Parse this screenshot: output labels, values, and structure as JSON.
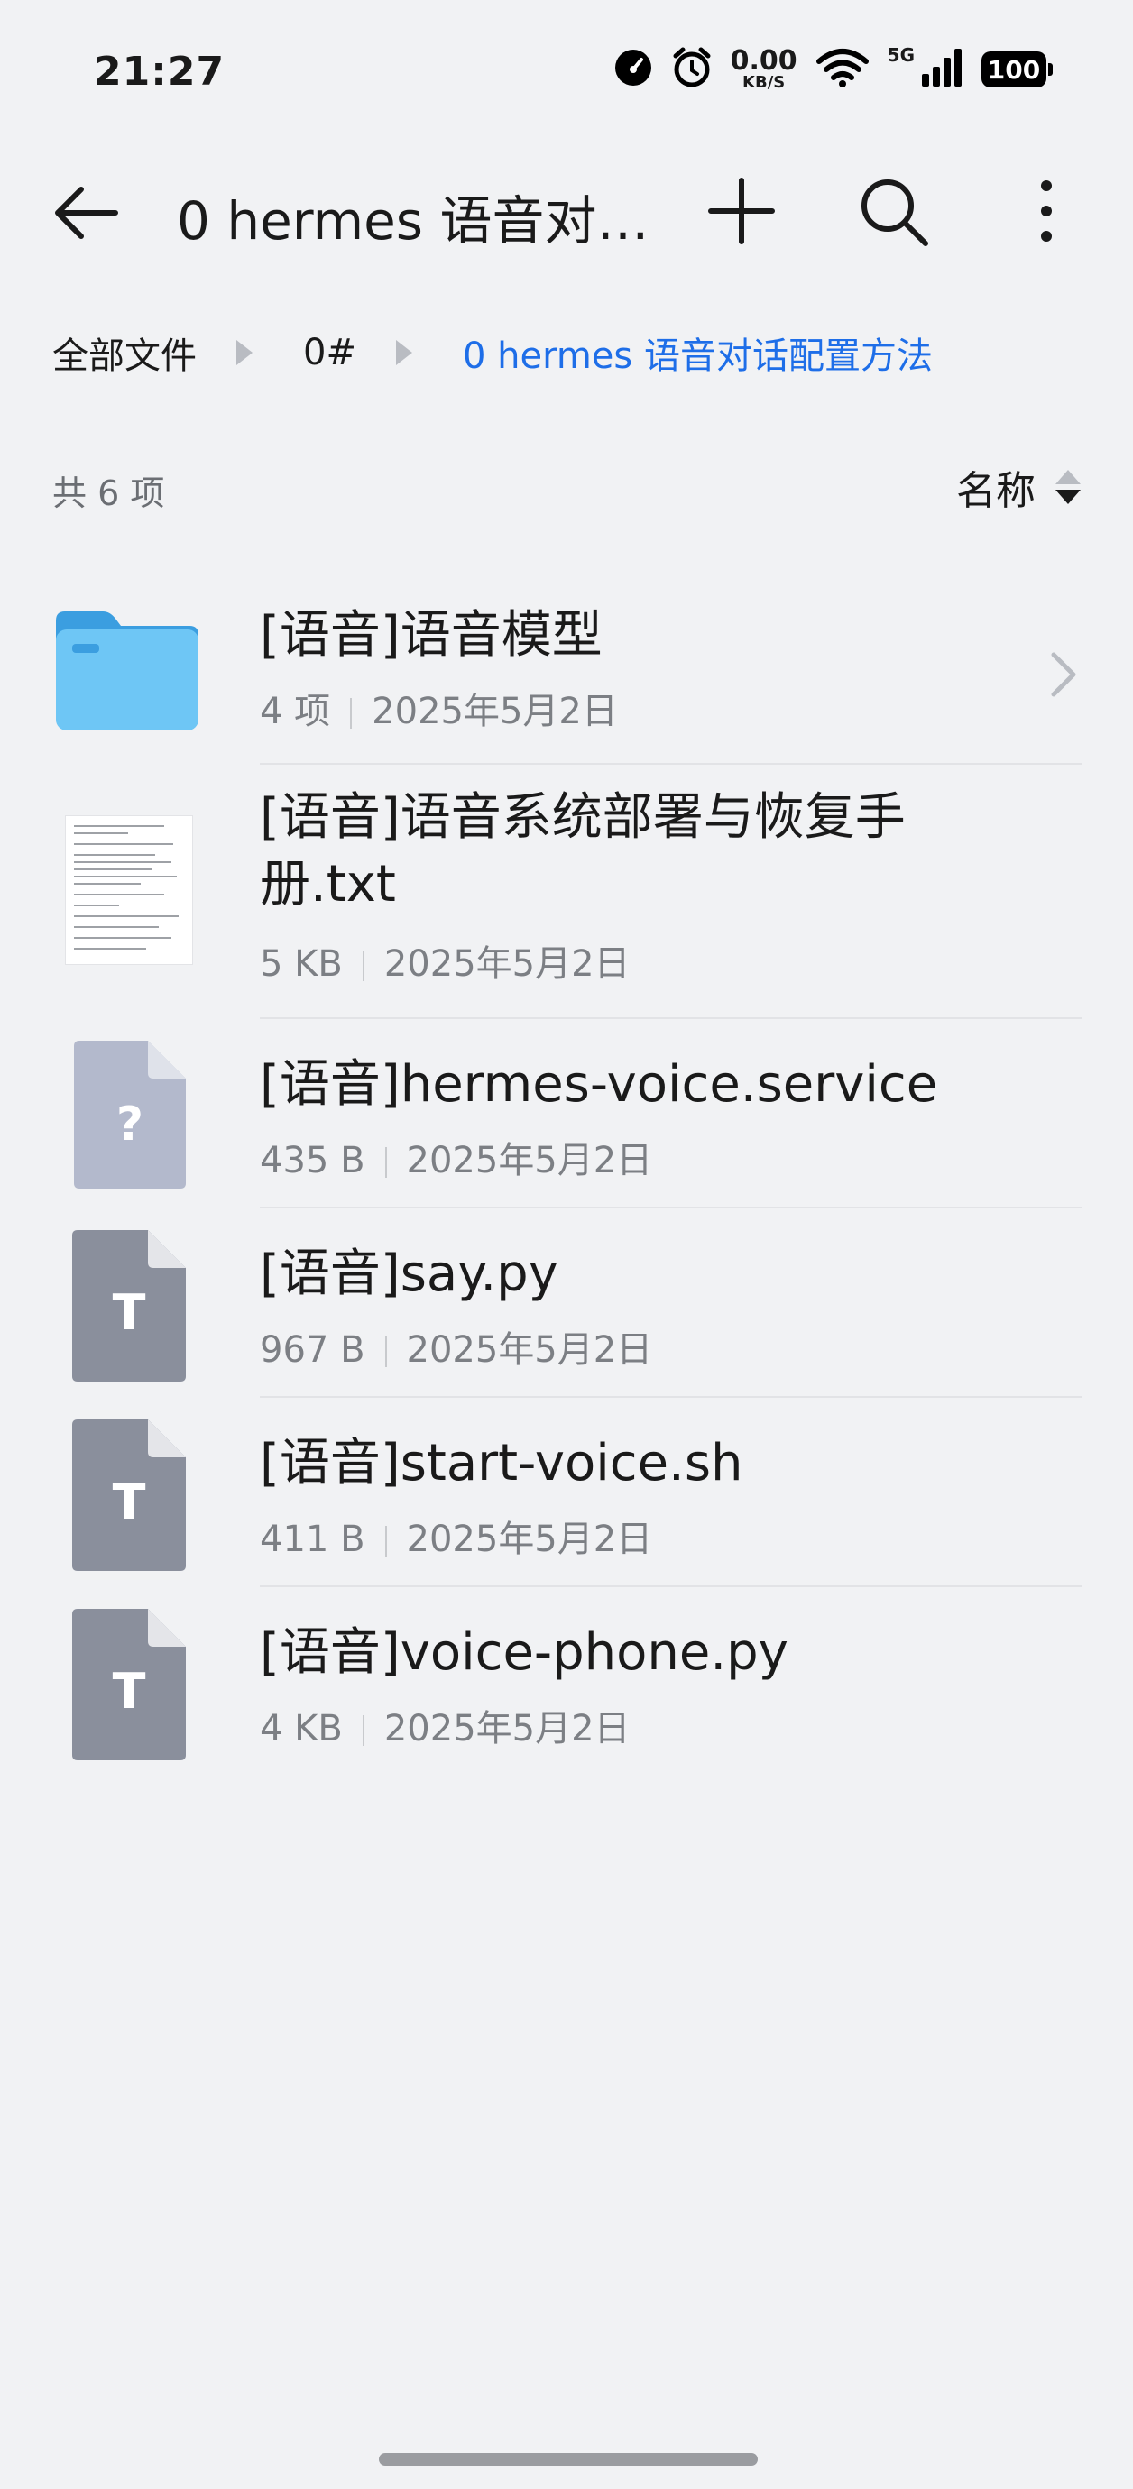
{
  "status_bar": {
    "time": "21:27",
    "net_speed_value": "0.00",
    "net_speed_unit": "KB/S",
    "signal_label": "5G",
    "battery": "100"
  },
  "toolbar": {
    "title": "0 hermes 语音对…"
  },
  "breadcrumb": [
    "全部文件",
    "0#",
    "0 hermes 语音对话配置方法"
  ],
  "list_header": {
    "count": "共 6 项",
    "sort_label": "名称"
  },
  "files": [
    {
      "name": "[语音]语音模型",
      "size": "4 项",
      "date": "2025年5月2日",
      "kind": "folder"
    },
    {
      "name": "[语音]语音系统部署与恢复手册.txt",
      "size": "5 KB",
      "date": "2025年5月2日",
      "kind": "text-preview"
    },
    {
      "name": "[语音]hermes-voice.service",
      "size": "435 B",
      "date": "2025年5月2日",
      "kind": "unknown"
    },
    {
      "name": "[语音]say.py",
      "size": "967 B",
      "date": "2025年5月2日",
      "kind": "text"
    },
    {
      "name": "[语音]start-voice.sh",
      "size": "411 B",
      "date": "2025年5月2日",
      "kind": "text"
    },
    {
      "name": "[语音]voice-phone.py",
      "size": "4 KB",
      "date": "2025年5月2日",
      "kind": "text"
    }
  ],
  "colors": {
    "background": "#f1f2f4",
    "accent": "#1e6ee8",
    "folder": "#6ec6f5",
    "text_file_icon": "#8a8f9c",
    "unknown_file_icon": "#b3b9cc"
  }
}
